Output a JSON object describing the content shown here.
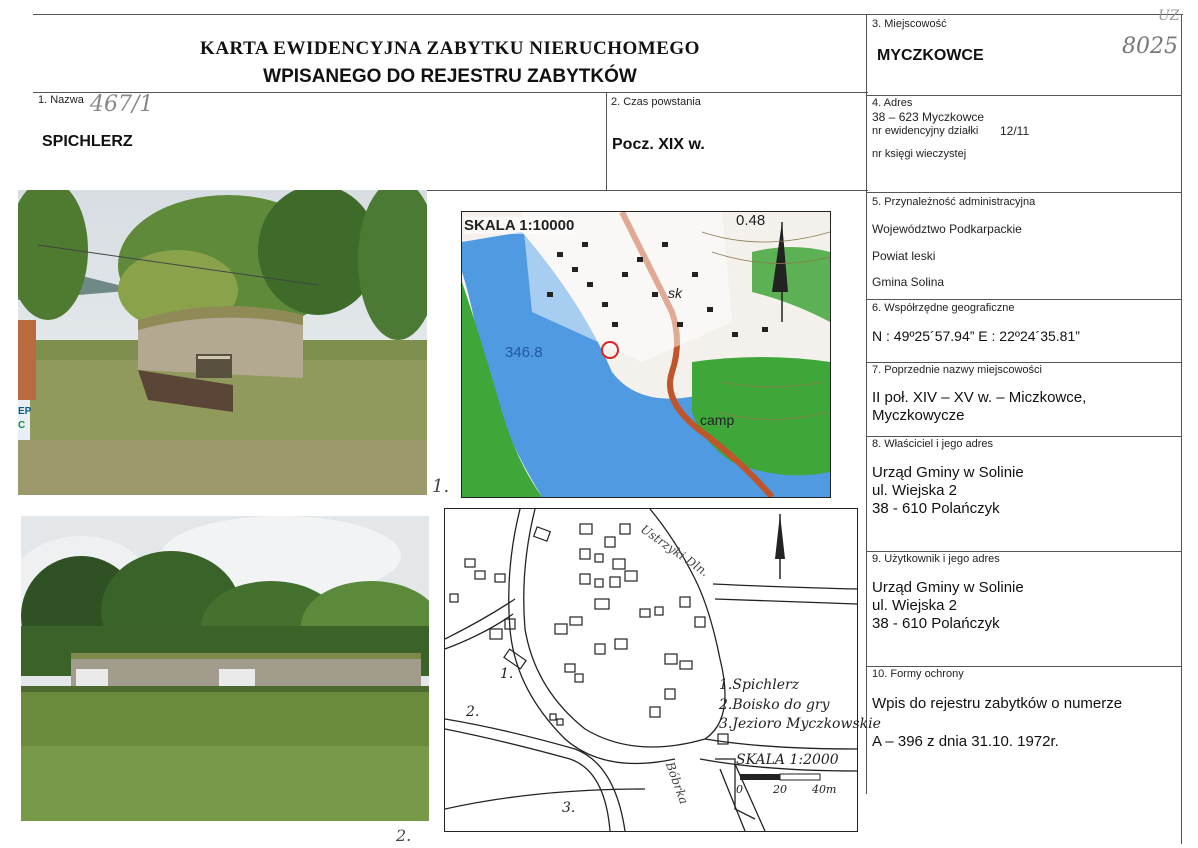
{
  "header": {
    "title_line1": "KARTA EWIDENCYJNA ZABYTKU NIERUCHOMEGO",
    "title_line2": "WPISANEGO DO REJESTRU ZABYTKÓW",
    "corner_mark": "UZ",
    "registry_number": "8025"
  },
  "fields": {
    "nazwa": {
      "label": "1. Nazwa",
      "note": "467/1",
      "value": "SPICHLERZ"
    },
    "czas": {
      "label": "2. Czas powstania",
      "value": "Pocz. XIX w."
    },
    "miejscowosc": {
      "label": "3. Miejscowość",
      "value": "MYCZKOWCE"
    },
    "adres": {
      "label": "4. Adres",
      "line1": "38 – 623 Myczkowce",
      "dzialka_label": "nr ewidencyjny działki",
      "dzialka_value": "12/11",
      "ksiega_label": "nr księgi wieczystej"
    },
    "przynaleznosc": {
      "label": "5. Przynależność administracyjna",
      "wojewodztwo": "Województwo Podkarpackie",
      "powiat": "Powiat leski",
      "gmina": "Gmina Solina"
    },
    "wspolrzedne": {
      "label": "6. Współrzędne geograficzne",
      "value": "N : 49º25´57.94”  E : 22º24´35.81”"
    },
    "poprzednie": {
      "label": "7. Poprzednie nazwy miejscowości",
      "line1": "II poł. XIV – XV w. – Miczkowce,",
      "line2": "Myczkowycze"
    },
    "wlasciciel": {
      "label": "8. Właściciel i jego adres",
      "line1": "Urząd Gminy w Solinie",
      "line2": "ul. Wiejska 2",
      "line3": "38 - 610 Polańczyk"
    },
    "uzytkownik": {
      "label": "9. Użytkownik i jego adres",
      "line1": "Urząd Gminy w Solinie",
      "line2": "ul. Wiejska 2",
      "line3": "38 - 610 Polańczyk"
    },
    "formy": {
      "label": "10. Formy ochrony",
      "line1": "Wpis do rejestru zabytków o numerze",
      "line2": "A – 396 z dnia 31.10. 1972r."
    }
  },
  "topo_map": {
    "scale": "SKALA 1:10000",
    "elevation1": "346.8",
    "elevation2": "0.48",
    "label_camp": "camp",
    "label_sk": "sk"
  },
  "sketch_map": {
    "road_top": "Ustrzyki Dln.",
    "road_bottom": "Bóbrka",
    "legend1": "1.Spichlerz",
    "legend2": "2.Boisko do gry",
    "legend3": "3.Jezioro Myczkowskie",
    "scale": "SKALA 1:2000",
    "scale_0": "0",
    "scale_20": "20",
    "scale_40": "40m",
    "marker1": "1.",
    "marker2": "2.",
    "marker3": "3."
  },
  "photo_labels": {
    "photo1": "1.",
    "photo2": "2."
  },
  "side_stamp": {
    "line1": "EP",
    "line2": "C"
  },
  "colors": {
    "map_green": "#3fa63a",
    "map_water": "#4f9ae0",
    "map_road": "#c0542a",
    "line": "#555555"
  }
}
